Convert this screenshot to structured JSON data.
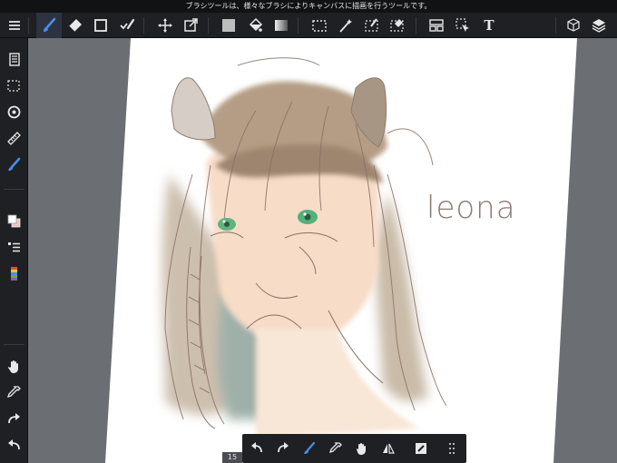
{
  "status_message": "ブラシツールは、様々なブラシによりキャンバスに描画を行うツールです。",
  "artwork_signature": "leona",
  "zoom_label": "15",
  "colors": {
    "toolbar_bg": "#1f2023",
    "accent": "#3a7bd5",
    "canvas_bg": "#6b6e73",
    "paper": "#ffffff"
  },
  "top_toolbar": {
    "left": [
      "menu-icon",
      "brush-icon",
      "eraser-icon",
      "rectangle-icon",
      "brush-select-icon"
    ],
    "center": [
      "move-icon",
      "transform-icon",
      "fill-swatch-icon",
      "bucket-icon",
      "gradient-icon",
      "select-rect-icon",
      "magic-wand-icon",
      "select-pen-icon",
      "select-eraser-icon"
    ],
    "right": [
      "frame-icon",
      "operation-icon",
      "text-icon",
      "3d-icon",
      "layers-icon"
    ],
    "text_tool_glyph": "T"
  },
  "sidebar": [
    "pages-icon",
    "selection-icon",
    "rotate-icon",
    "ruler-icon",
    "pen-icon",
    "color-icon",
    "layer-list-icon",
    "palette-icon",
    "hand-icon",
    "eyedropper-icon",
    "redo-icon",
    "undo-icon"
  ],
  "float_toolbar": [
    "undo-icon",
    "redo-icon",
    "brush-icon",
    "eyedropper-icon",
    "hand-icon",
    "flip-icon",
    "edit-icon",
    "grid-icon"
  ]
}
